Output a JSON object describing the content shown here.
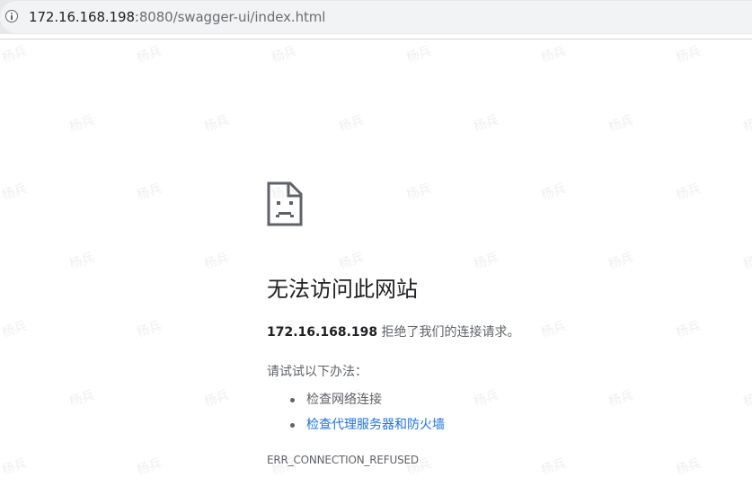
{
  "address_bar": {
    "url_host": "172.16.168.198",
    "url_rest": ":8080/swagger-ui/index.html"
  },
  "watermark": {
    "text": "杨兵"
  },
  "error_page": {
    "icon": "sad-document-icon",
    "title": "无法访问此网站",
    "host": "172.16.168.198",
    "message": " 拒绝了我们的连接请求。",
    "try_label": "请试试以下办法：",
    "suggestions": [
      {
        "label": "检查网络连接",
        "is_link": false
      },
      {
        "label": "检查代理服务器和防火墙",
        "is_link": true
      }
    ],
    "error_code": "ERR_CONNECTION_REFUSED"
  },
  "colors": {
    "link": "#1a73e8",
    "title_text": "#202124",
    "body_text": "#5f6368",
    "watermark": "#f2eeee"
  }
}
